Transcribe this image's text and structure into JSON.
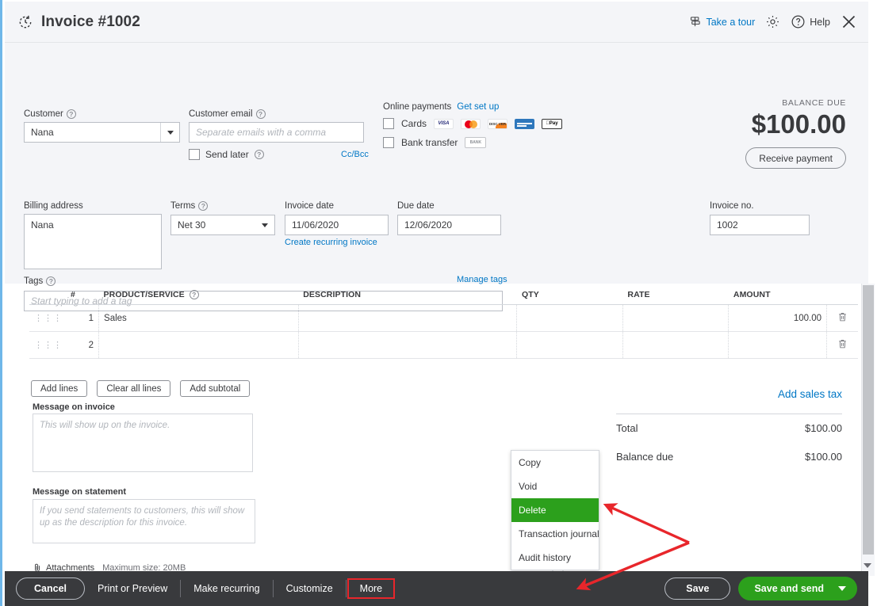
{
  "header": {
    "title": "Invoice #1002",
    "recurring_icon": "recurring-clock-icon",
    "tour_label": "Take a tour",
    "tour_icon": "signpost-icon",
    "gear_icon": "gear-icon",
    "help_icon": "question-circle-icon",
    "help_label": "Help",
    "close_icon": "close-icon"
  },
  "form": {
    "customer_label": "Customer",
    "customer_value": "Nana",
    "customer_email_label": "Customer email",
    "customer_email_placeholder": "Separate emails with a comma",
    "send_later_label": "Send later",
    "ccbcc_label": "Cc/Bcc",
    "online_payments_label": "Online payments",
    "get_set_up_label": "Get set up",
    "cards_label": "Cards",
    "card_brands": [
      "VISA",
      "mastercard",
      "DISCOVER",
      "AMEX",
      "Pay"
    ],
    "bank_transfer_label": "Bank transfer",
    "bank_badge": "BANK",
    "balance_due_label": "BALANCE DUE",
    "balance_due_amount": "$100.00",
    "receive_payment_label": "Receive payment",
    "billing_address_label": "Billing address",
    "billing_address_value": "Nana",
    "terms_label": "Terms",
    "terms_value": "Net 30",
    "invoice_date_label": "Invoice date",
    "invoice_date_value": "11/06/2020",
    "due_date_label": "Due date",
    "due_date_value": "12/06/2020",
    "create_recurring_label": "Create recurring invoice",
    "invoice_no_label": "Invoice no.",
    "invoice_no_value": "1002",
    "tags_label": "Tags",
    "manage_tags_label": "Manage tags",
    "tags_placeholder": "Start typing to add a tag"
  },
  "line_table": {
    "columns": [
      "#",
      "PRODUCT/SERVICE",
      "DESCRIPTION",
      "QTY",
      "RATE",
      "AMOUNT"
    ],
    "rows": [
      {
        "num": "1",
        "product": "Sales",
        "description": "",
        "qty": "",
        "rate": "",
        "amount": "100.00"
      },
      {
        "num": "2",
        "product": "",
        "description": "",
        "qty": "",
        "rate": "",
        "amount": ""
      }
    ]
  },
  "line_buttons": {
    "add_lines": "Add lines",
    "clear_all_lines": "Clear all lines",
    "add_subtotal": "Add subtotal"
  },
  "messages": {
    "invoice_label": "Message on invoice",
    "invoice_placeholder": "This will show up on the invoice.",
    "statement_label": "Message on statement",
    "statement_placeholder": "If you send statements to customers, this will show up as the description for this invoice."
  },
  "totals": {
    "add_sales_tax": "Add sales tax",
    "rows": [
      {
        "label": "Total",
        "value": "$100.00"
      },
      {
        "label": "Balance due",
        "value": "$100.00"
      }
    ]
  },
  "attachments": {
    "label": "Attachments",
    "max_size": "Maximum size: 20MB",
    "icon": "paperclip-icon"
  },
  "more_menu": {
    "items": [
      {
        "label": "Copy",
        "selected": false
      },
      {
        "label": "Void",
        "selected": false
      },
      {
        "label": "Delete",
        "selected": true
      },
      {
        "label": "Transaction journal",
        "selected": false
      },
      {
        "label": "Audit history",
        "selected": false
      }
    ]
  },
  "footer": {
    "cancel": "Cancel",
    "print_or_preview": "Print or Preview",
    "make_recurring": "Make recurring",
    "customize": "Customize",
    "more": "More",
    "save": "Save",
    "save_and_send": "Save and send",
    "dropdown_icon": "chevron-down-icon"
  },
  "colors": {
    "accent_link": "#0077c5",
    "green": "#2ca01c",
    "dark_bar": "#393a3d",
    "panel_bg": "#f4f5f8",
    "annotation_red": "#e8262b"
  }
}
